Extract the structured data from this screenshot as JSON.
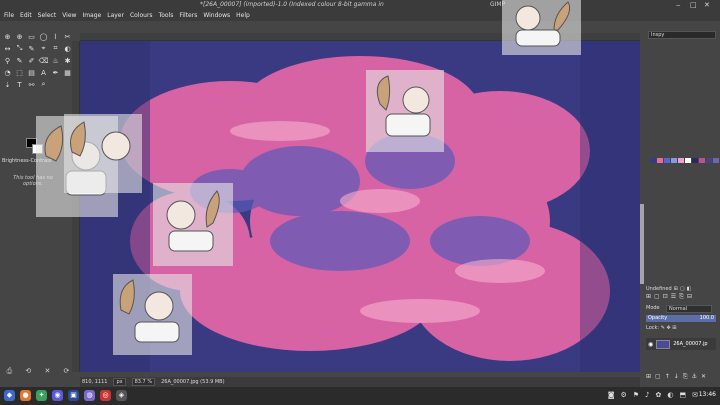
{
  "window": {
    "title": "*[26A_00007] (imported)-1.0 (Indexed colour 8-bit gamma in",
    "app_name": "GIMP",
    "controls": [
      "‒",
      "□",
      "✕"
    ]
  },
  "menubar": [
    "File",
    "Edit",
    "Select",
    "View",
    "Image",
    "Layer",
    "Colours",
    "Tools",
    "Filters",
    "Windows",
    "Help"
  ],
  "toolbox": {
    "tools": [
      "⊕",
      "⊕",
      "▭",
      "◯",
      "⌇",
      "✂",
      "↔",
      "⤡",
      "✎",
      "⌖",
      "⌗",
      "◐",
      "⚲",
      "✎",
      "✐",
      "⌫",
      "♨",
      "✱",
      "◔",
      "⬚",
      "▤",
      "A",
      "✒",
      "▦",
      "⇣",
      "T",
      "⚯",
      "⌕",
      "",
      ""
    ],
    "options_tab": "Brightness-Contrast",
    "no_options_message": "This tool has no options.",
    "bottom_buttons": [
      "⎙",
      "⟲",
      "✕",
      "⟳"
    ]
  },
  "canvas": {
    "background_color": "#3a3a82",
    "petal_color": "#e868a8"
  },
  "status": {
    "coords": "810, 1111",
    "unit": "px",
    "zoom": "83.7 %",
    "file_info": "26A_00007.jpg (53.9 MB)"
  },
  "dock": {
    "filter_field": "Inspy",
    "swatches": [
      "#3a3a82",
      "#e868a8",
      "#5566cc",
      "#8899dd",
      "#f0a0c8",
      "#ffffff",
      "#2a2a5a",
      "#c05090",
      "#444488",
      "#6a6aa8"
    ],
    "tabs": [
      "Undefined",
      "⊞",
      "▢",
      "◧"
    ],
    "buttons": [
      "⊞",
      "▢",
      "⊡",
      "☰",
      "⎘",
      "⊟"
    ],
    "mode_label": "Mode",
    "mode_value": "Normal",
    "opacity_label": "Opacity",
    "opacity_value": "100.0",
    "lock_label": "Lock:",
    "lock_icons": "✎ ✥ ⊞",
    "layer_name": "26A_00007.jp",
    "bottom_buttons": [
      "⊞",
      "▢",
      "↑",
      "↓",
      "⎘",
      "⚓",
      "✕"
    ]
  },
  "taskbar": {
    "apps": [
      {
        "glyph": "◆",
        "color": "#3a6ad0"
      },
      {
        "glyph": "●",
        "color": "#e8752d"
      },
      {
        "glyph": "✦",
        "color": "#3aa05a"
      },
      {
        "glyph": "◉",
        "color": "#5a5adc"
      },
      {
        "glyph": "▣",
        "color": "#2a4a9a"
      },
      {
        "glyph": "◍",
        "color": "#7a6ad0"
      },
      {
        "glyph": "◎",
        "color": "#cc3333"
      },
      {
        "glyph": "◈",
        "color": "#555555"
      }
    ],
    "tray": [
      "◙",
      "⚙",
      "⚑",
      "♪",
      "✿",
      "◐",
      "⬒",
      "✉"
    ],
    "time": "13:46"
  }
}
